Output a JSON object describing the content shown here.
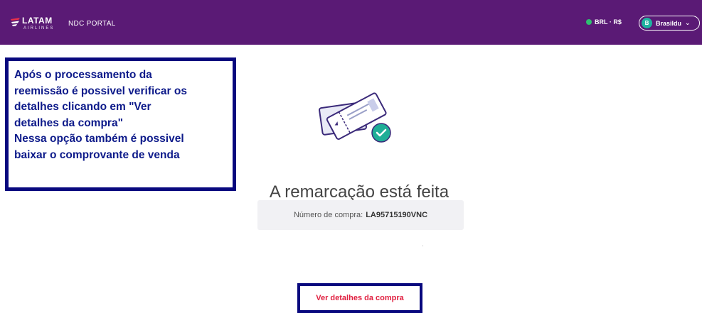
{
  "header": {
    "logo_text": "LATAM",
    "logo_sub": "AIRLINES",
    "portal_label": "NDC PORTAL",
    "currency_label": "BRL · R$",
    "user_initial": "B",
    "user_name": "Brasildu",
    "colors": {
      "bar": "#5a1a75",
      "accent_green": "#2fbf71"
    }
  },
  "annotation": {
    "lines": [
      "Após o processamento da",
      "reemissão é possivel verificar os",
      "detalhes clicando em \"Ver",
      "detalhes da compra\"",
      "Nessa opção também é possivel",
      "baixar o comprovante de venda"
    ],
    "border_color": "#08087e"
  },
  "main": {
    "title": "A remarcação está feita",
    "purchase_label": "Número de compra:",
    "purchase_code": "LA95715190VNC",
    "details_button": "Ver detalhes da compra"
  }
}
